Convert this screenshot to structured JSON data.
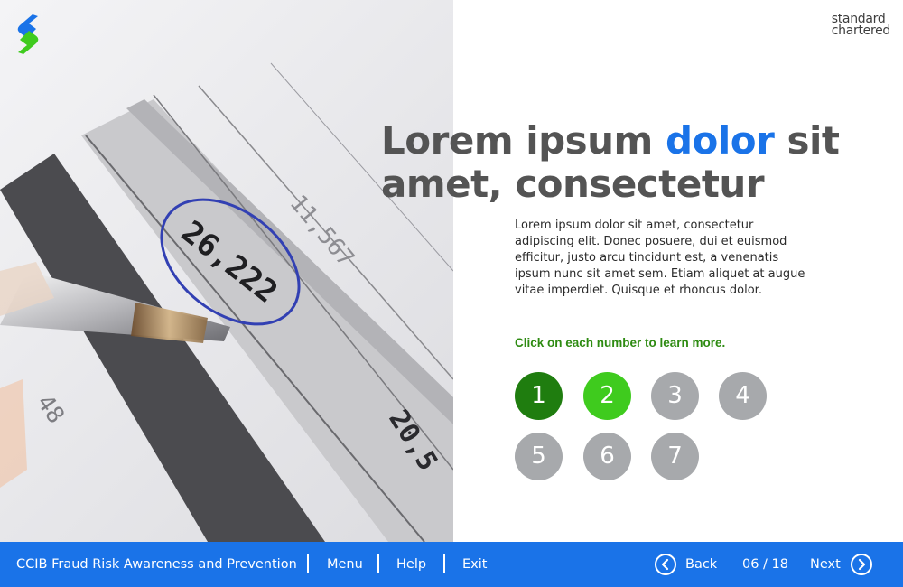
{
  "brand": {
    "logo_icon": "standard-chartered-logo-icon",
    "wordmark_line1": "standard",
    "wordmark_line2": "chartered",
    "colors": {
      "blue": "#1a73e8",
      "green": "#3fcb1e",
      "dark_green": "#1f7d0f",
      "grey": "#a7a9ac"
    }
  },
  "hero": {
    "photo_numbers": [
      "26,222",
      "11,567",
      "48",
      "20,5"
    ]
  },
  "headline": {
    "part1": "Lorem ipsum ",
    "accent": "dolor",
    "part2": " sit amet, consectetur"
  },
  "body": "Lorem ipsum dolor sit amet, consectetur adipiscing elit. Donec posuere, dui et euismod efficitur, justo arcu tincidunt est, a venenatis ipsum nunc sit amet sem. Etiam aliquet at augue vitae imperdiet. Quisque et rhoncus dolor.",
  "instruction": "Click on each number to learn more.",
  "numbers": [
    {
      "label": "1",
      "state": "visited"
    },
    {
      "label": "2",
      "state": "active"
    },
    {
      "label": "3",
      "state": "unvisited"
    },
    {
      "label": "4",
      "state": "unvisited"
    },
    {
      "label": "5",
      "state": "unvisited"
    },
    {
      "label": "6",
      "state": "unvisited"
    },
    {
      "label": "7",
      "state": "unvisited"
    }
  ],
  "footer": {
    "course_title": "CCIB Fraud Risk Awareness and Prevention",
    "menu": "Menu",
    "help": "Help",
    "exit": "Exit",
    "back": "Back",
    "page_indicator": "06 / 18",
    "next": "Next",
    "back_icon": "chevron-left-circle-icon",
    "next_icon": "chevron-right-circle-icon"
  }
}
